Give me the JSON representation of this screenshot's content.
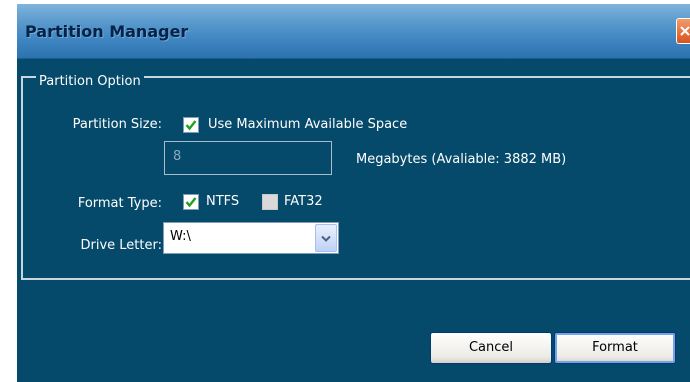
{
  "window": {
    "title": "Partition Manager"
  },
  "group": {
    "legend": "Partition Option",
    "partition_size": {
      "label": "Partition Size:",
      "checkbox_label": "Use Maximum Available Space",
      "checked": true,
      "input_value": "8",
      "input_unit": "Megabytes (Avaliable: 3882 MB)"
    },
    "format_type": {
      "label": "Format Type:",
      "options": [
        {
          "label": "NTFS",
          "checked": true
        },
        {
          "label": "FAT32",
          "checked": false
        }
      ]
    },
    "drive_letter": {
      "label": "Drive Letter:",
      "selected": "W:\\"
    }
  },
  "buttons": {
    "cancel": "Cancel",
    "format": "Format"
  },
  "colors": {
    "background": "#064a6b",
    "titlebar": "#3f86c2",
    "close": "#d8521e"
  }
}
